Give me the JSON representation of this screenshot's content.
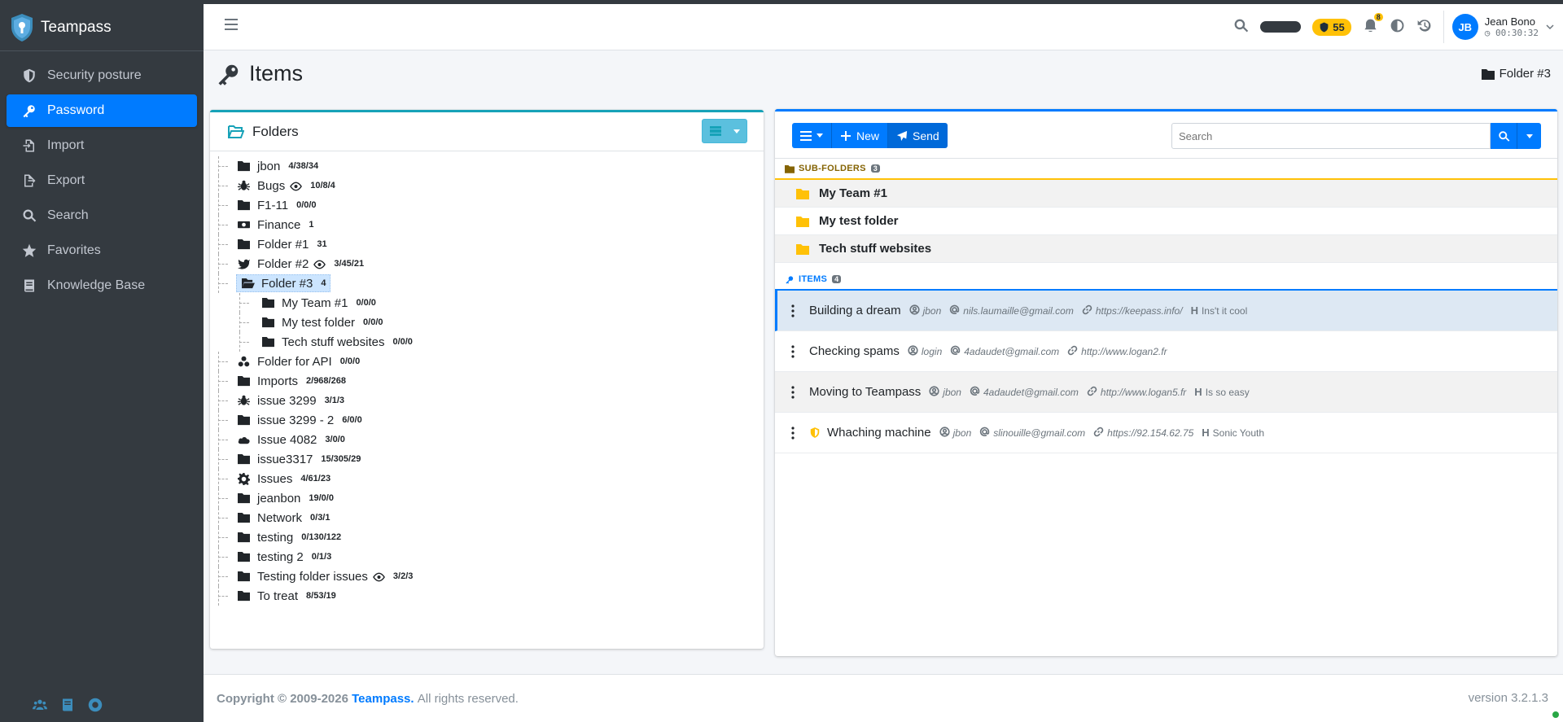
{
  "app": {
    "name": "Teampass"
  },
  "sidebar": {
    "items": [
      {
        "label": "Security posture",
        "icon": "shield-icon",
        "active": false
      },
      {
        "label": "Password",
        "icon": "key-icon",
        "active": true
      },
      {
        "label": "Import",
        "icon": "file-import-icon",
        "active": false
      },
      {
        "label": "Export",
        "icon": "file-export-icon",
        "active": false
      },
      {
        "label": "Search",
        "icon": "search-icon",
        "active": false
      },
      {
        "label": "Favorites",
        "icon": "star-icon",
        "active": false
      },
      {
        "label": "Knowledge Base",
        "icon": "book-icon",
        "active": false
      }
    ],
    "bottom_icons": [
      "users-icon",
      "book-icon",
      "support-icon"
    ]
  },
  "navbar": {
    "security_score": "55",
    "notifications": "8",
    "user_initials": "JB",
    "user_name": "Jean Bono",
    "session_time": "00:30:32"
  },
  "page": {
    "title": "Items",
    "breadcrumb": "Folder #3"
  },
  "folders_panel": {
    "title": "Folders",
    "tree": [
      {
        "label": "jbon",
        "count": "4/38/34",
        "icon": "folder-icon",
        "level": 0
      },
      {
        "label": "Bugs",
        "count": "10/8/4",
        "icon": "bug-icon",
        "level": 0,
        "eye": true
      },
      {
        "label": "F1-11",
        "count": "0/0/0",
        "icon": "folder-icon",
        "level": 0
      },
      {
        "label": "Finance",
        "count": "1",
        "icon": "money-icon",
        "level": 0
      },
      {
        "label": "Folder #1",
        "count": "31",
        "icon": "folder-icon",
        "level": 0
      },
      {
        "label": "Folder #2",
        "count": "3/45/21",
        "icon": "twitter-icon",
        "level": 0,
        "eye": true
      },
      {
        "label": "Folder #3",
        "count": "4",
        "icon": "folder-open-icon",
        "level": 0,
        "selected": true
      },
      {
        "label": "My Team #1",
        "count": "0/0/0",
        "icon": "folder-icon",
        "level": 1
      },
      {
        "label": "My test folder",
        "count": "0/0/0",
        "icon": "folder-icon",
        "level": 1
      },
      {
        "label": "Tech stuff websites",
        "count": "0/0/0",
        "icon": "folder-icon",
        "level": 1
      },
      {
        "label": "Folder for API",
        "count": "0/0/0",
        "icon": "biohazard-icon",
        "level": 0
      },
      {
        "label": "Imports",
        "count": "2/968/268",
        "icon": "folder-icon",
        "level": 0
      },
      {
        "label": "issue 3299",
        "count": "3/1/3",
        "icon": "bug-icon",
        "level": 0
      },
      {
        "label": "issue 3299 - 2",
        "count": "6/0/0",
        "icon": "folder-icon",
        "level": 0
      },
      {
        "label": "Issue 4082",
        "count": "3/0/0",
        "icon": "cloud-icon",
        "level": 0
      },
      {
        "label": "issue3317",
        "count": "15/305/29",
        "icon": "folder-icon",
        "level": 0
      },
      {
        "label": "Issues",
        "count": "4/61/23",
        "icon": "gear-icon",
        "level": 0
      },
      {
        "label": "jeanbon",
        "count": "19/0/0",
        "icon": "folder-icon",
        "level": 0
      },
      {
        "label": "Network",
        "count": "0/3/1",
        "icon": "folder-icon",
        "level": 0
      },
      {
        "label": "testing",
        "count": "0/130/122",
        "icon": "folder-icon",
        "level": 0
      },
      {
        "label": "testing 2",
        "count": "0/1/3",
        "icon": "folder-icon",
        "level": 0
      },
      {
        "label": "Testing folder issues",
        "count": "3/2/3",
        "icon": "folder-icon",
        "level": 0,
        "eye": true
      },
      {
        "label": "To treat",
        "count": "8/53/19",
        "icon": "folder-icon",
        "level": 0
      }
    ]
  },
  "items_panel": {
    "new_label": "New",
    "send_label": "Send",
    "search_placeholder": "Search",
    "subfolders_label": "SUB-FOLDERS",
    "subfolders_count": "3",
    "subfolders": [
      "My Team #1",
      "My test folder",
      "Tech stuff websites"
    ],
    "items_label": "ITEMS",
    "items_count": "4",
    "items": [
      {
        "title": "Building a dream",
        "login": "jbon",
        "email": "nils.laumaille@gmail.com",
        "url": "https://keepass.info/",
        "tag": "Ins't it cool",
        "shield": false
      },
      {
        "title": "Checking spams",
        "login": "login",
        "email": "4adaudet@gmail.com",
        "url": "http://www.logan2.fr",
        "tag": "",
        "shield": false
      },
      {
        "title": "Moving to Teampass",
        "login": "jbon",
        "email": "4adaudet@gmail.com",
        "url": "http://www.logan5.fr",
        "tag": "Is so easy",
        "shield": false
      },
      {
        "title": "Whaching machine",
        "login": "jbon",
        "email": "slinouille@gmail.com",
        "url": "https://92.154.62.75",
        "tag": "Sonic Youth",
        "shield": true
      }
    ]
  },
  "footer": {
    "copyright": "Copyright © 2009-2026",
    "brand": "Teampass.",
    "rights": "All rights reserved.",
    "version": "version 3.2.1.3"
  },
  "colors": {
    "primary": "#007bff",
    "sidebar": "#343a40",
    "info": "#17a2b8",
    "warning": "#ffc107"
  }
}
